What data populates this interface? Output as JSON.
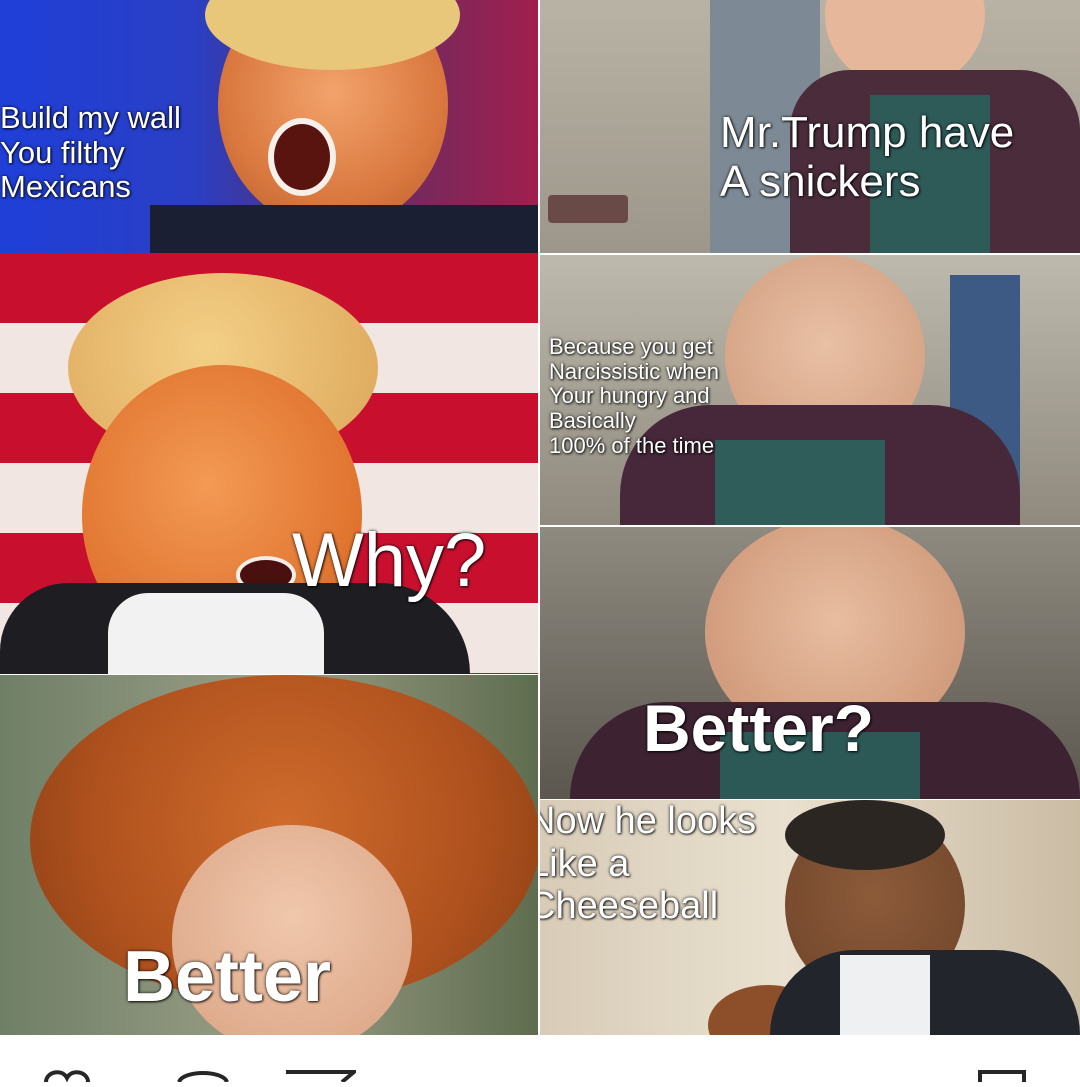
{
  "panels": {
    "p1": {
      "caption": "Build my wall\nYou filthy\nMexicans"
    },
    "p2": {
      "caption": "Mr.Trump have\nA snickers"
    },
    "p3": {
      "caption": "Why?"
    },
    "p4": {
      "caption": "Because you get\nNarcissistic when\nYour hungry and\nBasically\n100% of the time"
    },
    "p5": {
      "caption": "Better?"
    },
    "p6": {
      "caption": "Better"
    },
    "p7": {
      "caption": "Now he looks\nLike a\nCheeseball"
    }
  },
  "action_bar": {
    "icons": [
      "heart-icon",
      "comment-icon",
      "share-icon",
      "bookmark-icon"
    ]
  },
  "colors": {
    "caption": "#ffffff",
    "background": "#ffffff",
    "icon": "#262626"
  }
}
